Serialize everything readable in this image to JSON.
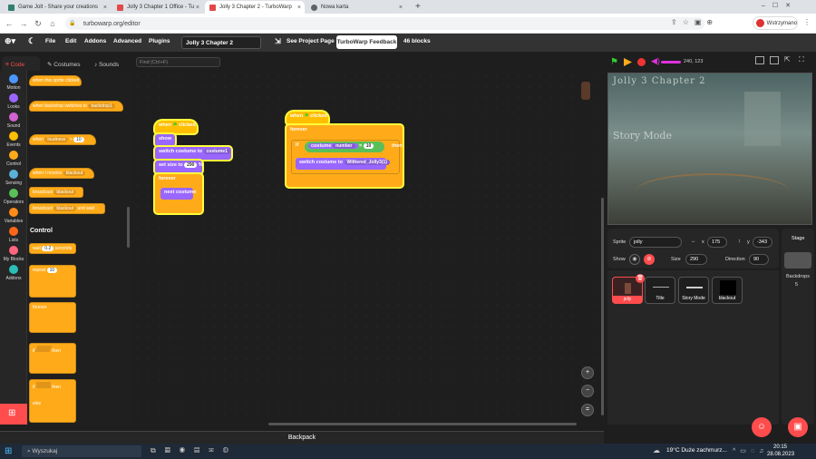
{
  "browser": {
    "tabs": [
      {
        "label": "Game Jolt - Share your creations",
        "active": false
      },
      {
        "label": "Jolly 3 Chapter 1 Office - Tu",
        "active": false
      },
      {
        "label": "Jolly 3 Chapter 2 - TurboWarp",
        "active": true
      },
      {
        "label": "Nowa karta",
        "active": false
      }
    ],
    "url": "turbowarp.org/editor",
    "profile": "Wstrzymano"
  },
  "menu": {
    "file": "File",
    "edit": "Edit",
    "addons": "Addons",
    "advanced": "Advanced",
    "plugins": "Plugins",
    "project_title": "Jolly 3 Chapter 2",
    "see_project": "See Project Page",
    "feedback": "TurboWarp Feedback",
    "block_count": "46 blocks"
  },
  "editor_tabs": {
    "code": "Code",
    "costumes": "Costumes",
    "sounds": "Sounds"
  },
  "find_placeholder": "Find (Ctrl+F)",
  "categories": [
    "Motion",
    "Looks",
    "Sound",
    "Events",
    "Control",
    "Sensing",
    "Operators",
    "Variables",
    "Lists",
    "My Blocks",
    "Addons"
  ],
  "category_colors": [
    "#4c97ff",
    "#9966ff",
    "#cf63cf",
    "#ffbf00",
    "#ffab19",
    "#5cb1d6",
    "#59c059",
    "#ff8c1a",
    "#ff661a",
    "#ff6680",
    "#29beb8"
  ],
  "palette": {
    "when_sprite_clicked": "when this sprite clicked",
    "when_backdrop": "when backdrop switches to",
    "backdrop_value": "backdrop1",
    "when_key": "when",
    "key_value": "loudness",
    "key_num": "10",
    "when_receive": "when I receive",
    "receive_value": "blackout",
    "broadcast": "broadcast",
    "broadcast_value": "blackout",
    "broadcast_wait": "broadcast",
    "broadcast_wait_value": "blackout",
    "and_wait": "and wait",
    "control_heading": "Control",
    "wait": "wait",
    "wait_value": "0.2",
    "seconds": "seconds",
    "repeat": "repeat",
    "repeat_value": "10",
    "forever": "forever",
    "if": "if",
    "then": "then",
    "if2": "if",
    "then2": "then",
    "else": "else"
  },
  "script1": {
    "when": "when",
    "clicked": "clicked",
    "show": "show",
    "switch_costume": "switch costume to",
    "costume_value": "costume1",
    "set_size": "set size to",
    "size_value": "290",
    "percent": "%",
    "forever": "forever",
    "next_costume": "next costume"
  },
  "script2": {
    "when": "when",
    "clicked": "clicked",
    "forever": "forever",
    "if": "if",
    "costume": "costume",
    "number": "number",
    "eq": "=",
    "eq_value": "10",
    "then": "then",
    "switch_costume": "switch costume to",
    "costume_value": "Withered_Jolly3(1)"
  },
  "backpack": "Backpack",
  "stage": {
    "coords": "240, 123",
    "title_text": "Jolly 3 Chapter 2",
    "sub_text": "Story Mode"
  },
  "sprite_info": {
    "sprite_label": "Sprite",
    "sprite_name": "jolly",
    "x_label": "x",
    "x_value": "175",
    "y_label": "y",
    "y_value": "-343",
    "show_label": "Show",
    "size_label": "Size",
    "size_value": "290",
    "direction_label": "Direction",
    "direction_value": "90"
  },
  "sprites": [
    "jolly",
    "Title",
    "Story Mode",
    "blackout"
  ],
  "stage_panel": {
    "label": "Stage",
    "backdrops_label": "Backdrops",
    "backdrops_count": "5"
  },
  "taskbar": {
    "search": "Wyszukaj",
    "weather": "19°C  Duże zachmurz...",
    "time": "20:15",
    "date": "28.08.2023"
  }
}
